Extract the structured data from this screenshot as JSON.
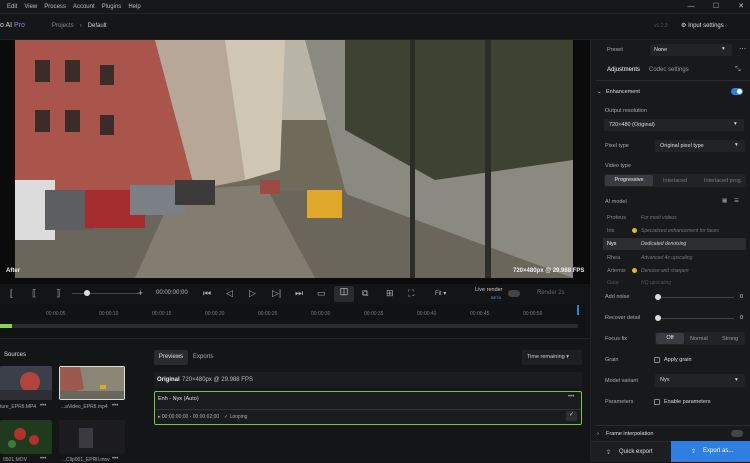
{
  "menu": [
    "Edit",
    "View",
    "Process",
    "Account",
    "Plugins",
    "Help"
  ],
  "window_controls": [
    "—",
    "☐",
    "✕"
  ],
  "app": {
    "name": "o AI",
    "badge": "Pro",
    "version": "v1.2.3"
  },
  "breadcrumb": [
    "Projects",
    "Default"
  ],
  "input_settings": "Input settings",
  "viewer": {
    "after_label": "After",
    "info": "720×480px @ 29.988 FPS"
  },
  "controls": {
    "timecode": "00:00:00;00",
    "fit": "Fit",
    "live_render": "Live render",
    "beta": "BETA",
    "render": "Render 2s"
  },
  "timeline_ticks": [
    "00:00:05",
    "00:00:10",
    "00:00:15",
    "00:00:20",
    "00:00:25",
    "00:00:30",
    "00:00:35",
    "00:00:40",
    "00:00:45",
    "00:00:50"
  ],
  "sources": {
    "title": "Sources",
    "items": [
      {
        "name": "ture_EPRII.MP4"
      },
      {
        "name": "...aVideo_EPRII.mp4"
      },
      {
        "name": "0501.MOV"
      },
      {
        "name": "...Clip001_EPRII.mov"
      }
    ]
  },
  "tabs": {
    "previews": "Previews",
    "exports": "Exports",
    "sort": "Time remaining"
  },
  "preview": {
    "original": "Original",
    "original_info": "720×480px @ 29.988 FPS",
    "enh": "Enh - Nyx (Auto)",
    "range": "00:00:00;00 - 00:00:02;00",
    "status": "Looping"
  },
  "panel": {
    "preset_label": "Preset",
    "preset_value": "None",
    "tab_adjustments": "Adjustments",
    "tab_codec": "Codec settings",
    "enhancement": "Enhancement",
    "output_resolution": "Output resolution",
    "resolution_value": "720×480 (Original)",
    "pixel_type": "Pixel type",
    "pixel_value": "Original pixel type",
    "video_type": "Video type",
    "video_types": [
      "Progressive",
      "Interlaced",
      "Interlaced prog."
    ],
    "ai_model": "AI model",
    "models": [
      {
        "name": "Proteus",
        "desc": "For most videos"
      },
      {
        "name": "Iris",
        "desc": "Specialized enhancement for faces"
      },
      {
        "name": "Nyx",
        "desc": "Dedicated denoising"
      },
      {
        "name": "Rhea",
        "desc": "Advanced 4x upscaling"
      },
      {
        "name": "Artemis",
        "desc": "Denoise and sharpen"
      },
      {
        "name": "Gaia",
        "desc": "HQ upscaling"
      }
    ],
    "add_noise": "Add noise",
    "add_noise_val": "0",
    "recover_detail": "Recover detail",
    "recover_detail_val": "0",
    "focus_fix": "Focus fix",
    "focus_opts": [
      "Off",
      "Normal",
      "Strong"
    ],
    "grain": "Grain",
    "apply_grain": "Apply grain",
    "model_variant": "Model variant",
    "variant_value": "Nyx",
    "parameters": "Parameters",
    "enable_parameters": "Enable parameters",
    "frame_interp": "Frame interpolation",
    "quick_export": "Quick export",
    "export_as": "Export as..."
  },
  "colors": {
    "accent": "#2f7fe0",
    "green": "#8fd14f",
    "yellow": "#e6b325"
  }
}
